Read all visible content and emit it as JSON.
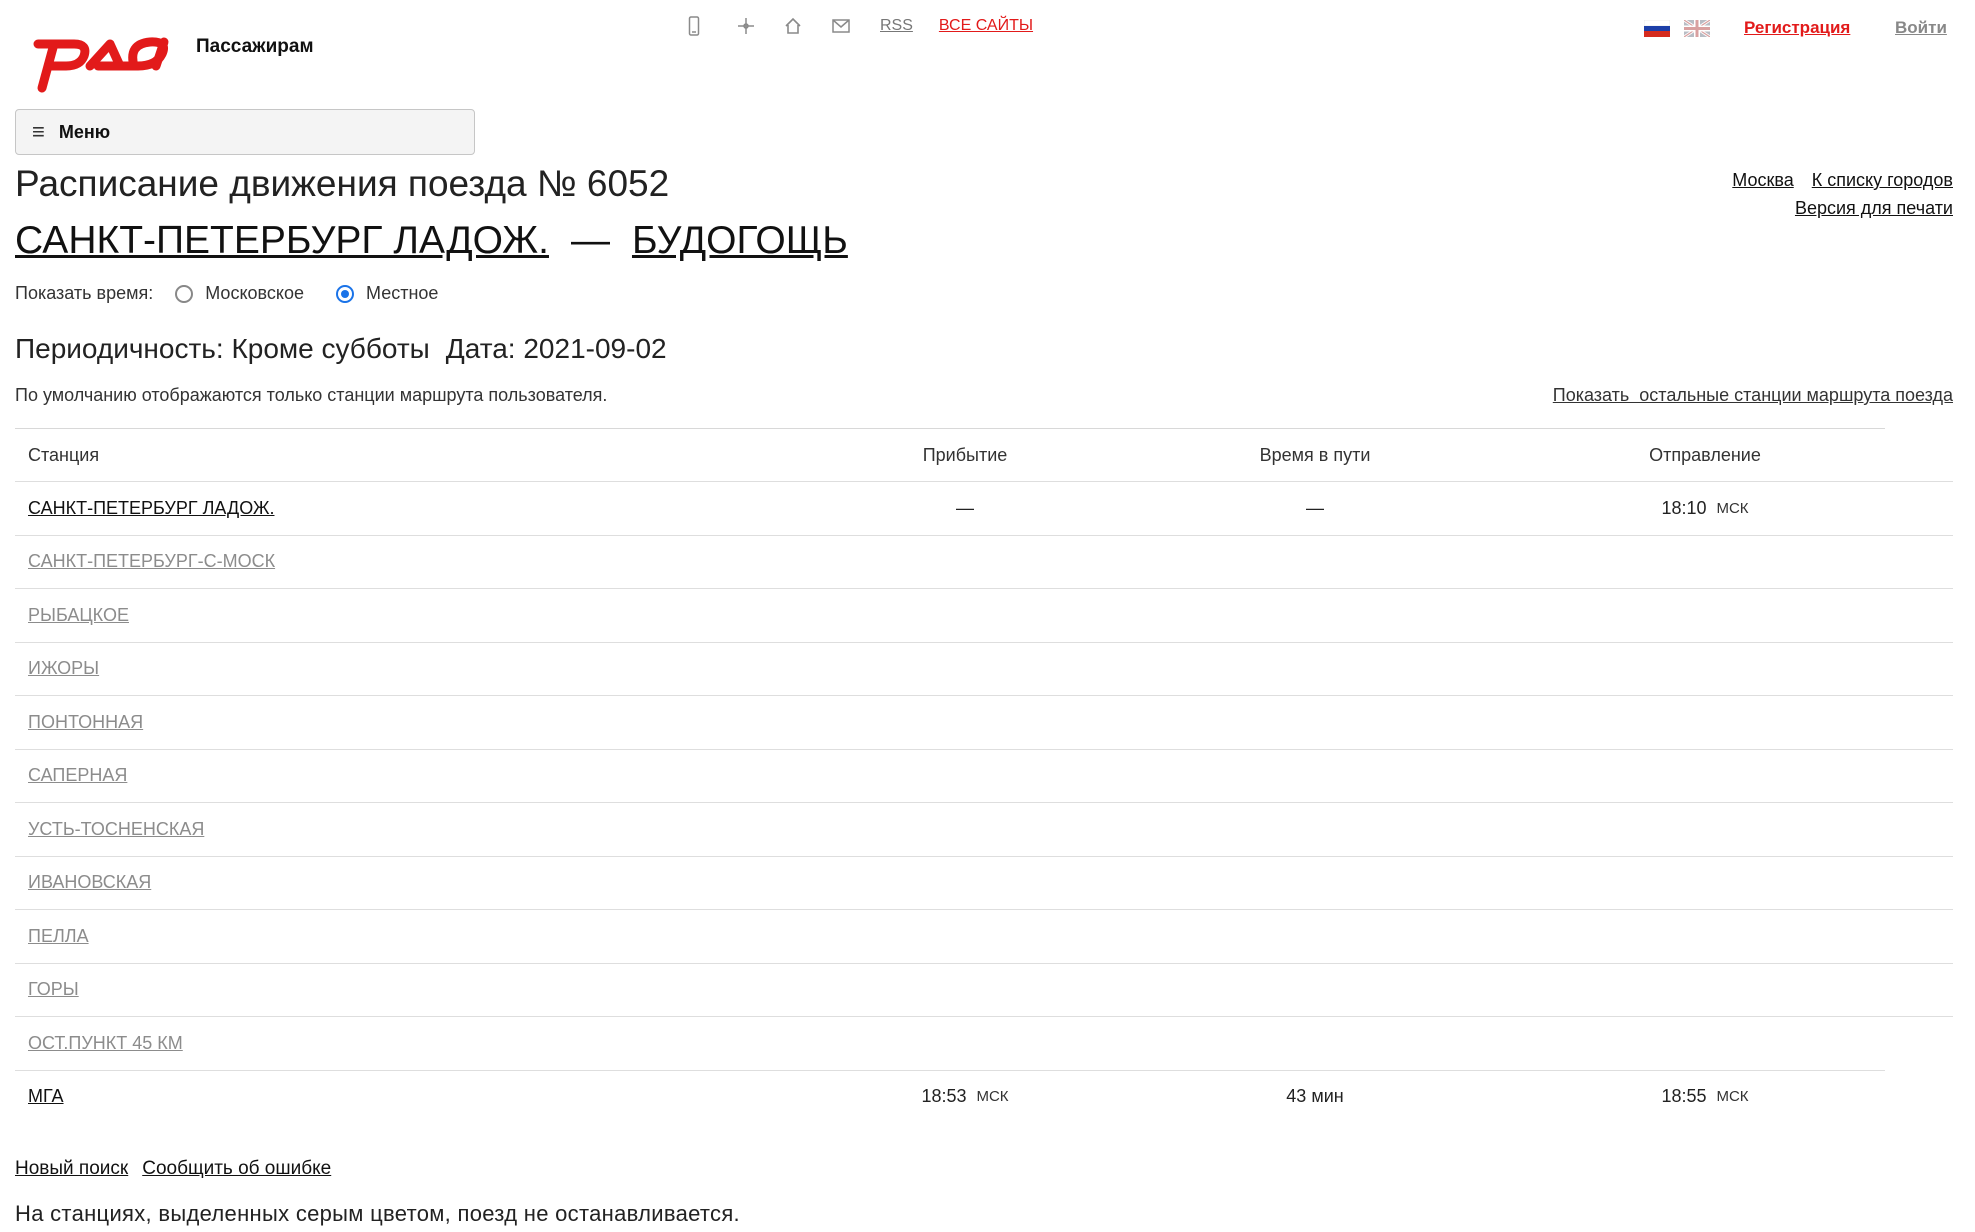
{
  "header": {
    "brand": "Пассажирам",
    "rss": "RSS",
    "all_sites": "ВСЕ САЙТЫ",
    "register": "Регистрация",
    "login": "Войти",
    "icons": [
      "mobile-icon",
      "sitemap-icon",
      "home-icon",
      "mail-icon"
    ]
  },
  "menu": {
    "label": "Меню"
  },
  "title": "Расписание движения поезда № 6052",
  "route": {
    "from": "САНКТ-ПЕТЕРБУРГ ЛАДОЖ.",
    "dash": "—",
    "to": "БУДОГОЩЬ"
  },
  "right_links": {
    "moscow": "Москва",
    "city_list": "К списку городов",
    "print": "Версия для печати"
  },
  "show_time": {
    "label": "Показать время:",
    "option_moscow": "Московское",
    "option_local": "Местное",
    "selected": "local"
  },
  "periodicity": {
    "text": "Периодичность: Кроме субботы",
    "date": "Дата: 2021-09-02"
  },
  "note": "По умолчанию отображаются только станции маршрута пользователя.",
  "show_all": "Показать  остальные станции маршрута поезда",
  "table": {
    "headers": {
      "station": "Станция",
      "arrival": "Прибытие",
      "travel": "Время в пути",
      "departure": "Отправление"
    },
    "rows": [
      {
        "station": "САНКТ-ПЕТЕРБУРГ ЛАДОЖ.",
        "arrival": "—",
        "arrival_tz": "",
        "travel": "—",
        "departure": "18:10",
        "departure_tz": "МСК"
      },
      {
        "station": "САНКТ-ПЕТЕРБУРГ-С-МОСК"
      },
      {
        "station": "РЫБАЦКОЕ"
      },
      {
        "station": "ИЖОРЫ"
      },
      {
        "station": "ПОНТОННАЯ"
      },
      {
        "station": "САПЕРНАЯ"
      },
      {
        "station": "УСТЬ-ТОСНЕНСКАЯ"
      },
      {
        "station": "ИВАНОВСКАЯ"
      },
      {
        "station": "ПЕЛЛА"
      },
      {
        "station": "ГОРЫ"
      },
      {
        "station": "ОСТ.ПУНКТ 45 КМ"
      },
      {
        "station": "МГА",
        "arrival": "18:53",
        "arrival_tz": "МСК",
        "travel": "43 мин",
        "departure": "18:55",
        "departure_tz": "МСК"
      }
    ]
  },
  "bottom_links": {
    "new_search": "Новый поиск",
    "report_error": "Сообщить об ошибке"
  },
  "footnote": "На станциях, выделенных серым цветом, поезд не останавливается.",
  "colors": {
    "brand_red": "#e21a1a",
    "gray_station": "#8c8c8c",
    "radio_blue": "#1a73e8"
  }
}
